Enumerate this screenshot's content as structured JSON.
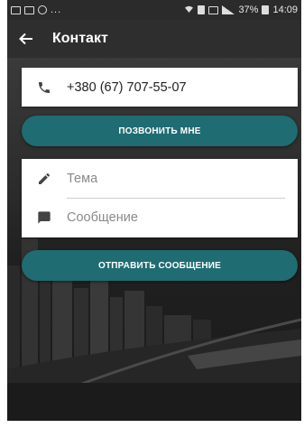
{
  "status_bar": {
    "battery": "37%",
    "time": "14:09",
    "left_ellipsis": "..."
  },
  "app_bar": {
    "title": "Контакт",
    "back_icon": "arrow-left-icon"
  },
  "phone_card": {
    "icon": "phone-icon",
    "phone_number": "+380 (67) 707-55-07"
  },
  "call_button": {
    "label": "ПОЗВОНИТЬ МНЕ"
  },
  "message_form": {
    "subject_icon": "pencil-icon",
    "subject_placeholder": "Тема",
    "message_icon": "message-icon",
    "message_placeholder": "Сообщение"
  },
  "send_button": {
    "label": "ОТПРАВИТЬ СООБЩЕНИЕ"
  },
  "colors": {
    "accent": "#1f6c72",
    "app_bar": "#2e2e2e",
    "status_bar": "#2b2b2b"
  }
}
